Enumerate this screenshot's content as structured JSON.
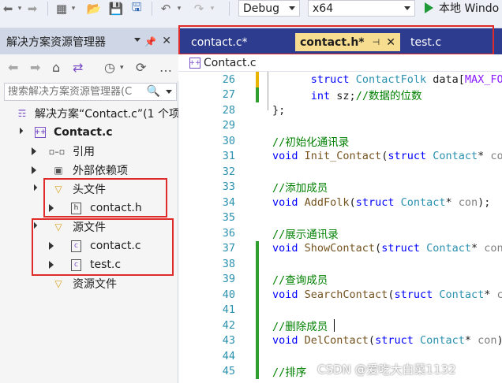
{
  "toolbar": {
    "config": "Debug",
    "platform": "x64",
    "run_label": "本地 Windo"
  },
  "solution_explorer": {
    "title": "解决方案资源管理器",
    "search_placeholder": "搜索解决方案资源管理器(C",
    "solution_label": "解决方案“Contact.c”(1 个项",
    "project_label": "Contact.c",
    "items": {
      "references": "引用",
      "external_deps": "外部依赖项",
      "header_folder": "头文件",
      "header_file": "contact.h",
      "source_folder": "源文件",
      "source_file_1": "contact.c",
      "source_file_2": "test.c",
      "resource_folder": "资源文件"
    }
  },
  "editor": {
    "tabs": [
      {
        "label": "contact.c*",
        "active": false
      },
      {
        "label": "contact.h*",
        "active": true
      },
      {
        "label": "test.c",
        "active": false
      }
    ],
    "nav_project": "Contact.c",
    "lines": [
      {
        "n": "26",
        "parts": [
          [
            "      ",
            "pl"
          ],
          [
            "struct ",
            "kw"
          ],
          [
            "ContactFolk ",
            "ty"
          ],
          [
            "data[",
            "pl"
          ],
          [
            "MAX_FOKL]",
            "mc"
          ]
        ]
      },
      {
        "n": "27",
        "parts": [
          [
            "      ",
            "pl"
          ],
          [
            "int ",
            "kw"
          ],
          [
            "sz;",
            "pl"
          ],
          [
            "//数据的位数",
            "cm"
          ]
        ]
      },
      {
        "n": "28",
        "parts": [
          [
            "};",
            "pl"
          ]
        ]
      },
      {
        "n": "29",
        "parts": []
      },
      {
        "n": "30",
        "parts": [
          [
            "//初始化通讯录",
            "cm"
          ]
        ]
      },
      {
        "n": "31",
        "parts": [
          [
            "void ",
            "kw"
          ],
          [
            "Init_Contact",
            "fn"
          ],
          [
            "(",
            "pl"
          ],
          [
            "struct ",
            "kw"
          ],
          [
            "Contact",
            "ty"
          ],
          [
            "* ",
            "pl"
          ],
          [
            "con",
            "pm"
          ]
        ]
      },
      {
        "n": "32",
        "parts": []
      },
      {
        "n": "33",
        "parts": [
          [
            "//添加成员",
            "cm"
          ]
        ]
      },
      {
        "n": "34",
        "parts": [
          [
            "void ",
            "kw"
          ],
          [
            "AddFolk",
            "fn"
          ],
          [
            "(",
            "pl"
          ],
          [
            "struct ",
            "kw"
          ],
          [
            "Contact",
            "ty"
          ],
          [
            "* ",
            "pl"
          ],
          [
            "con",
            "pm"
          ],
          [
            ");",
            "pl"
          ]
        ]
      },
      {
        "n": "35",
        "parts": []
      },
      {
        "n": "36",
        "parts": [
          [
            "//展示通讯录",
            "cm"
          ]
        ]
      },
      {
        "n": "37",
        "parts": [
          [
            "void ",
            "kw"
          ],
          [
            "ShowContact",
            "fn"
          ],
          [
            "(",
            "pl"
          ],
          [
            "struct ",
            "kw"
          ],
          [
            "Contact",
            "ty"
          ],
          [
            "* ",
            "pl"
          ],
          [
            "con",
            "pm"
          ],
          [
            ")",
            "pl"
          ]
        ]
      },
      {
        "n": "38",
        "parts": []
      },
      {
        "n": "39",
        "parts": [
          [
            "//查询成员",
            "cm"
          ]
        ]
      },
      {
        "n": "40",
        "parts": [
          [
            "void ",
            "kw"
          ],
          [
            "SearchContact",
            "fn"
          ],
          [
            "(",
            "pl"
          ],
          [
            "struct ",
            "kw"
          ],
          [
            "Contact",
            "ty"
          ],
          [
            "* ",
            "pl"
          ],
          [
            "co",
            "pm"
          ]
        ]
      },
      {
        "n": "41",
        "parts": []
      },
      {
        "n": "42",
        "parts": [
          [
            "//删除成员",
            "cm"
          ]
        ]
      },
      {
        "n": "43",
        "parts": [
          [
            "void ",
            "kw"
          ],
          [
            "DelContact",
            "fn"
          ],
          [
            "(",
            "pl"
          ],
          [
            "struct ",
            "kw"
          ],
          [
            "Contact",
            "ty"
          ],
          [
            "* ",
            "pl"
          ],
          [
            "con",
            "pm"
          ],
          [
            ");",
            "pl"
          ]
        ]
      },
      {
        "n": "44",
        "parts": []
      },
      {
        "n": "45",
        "parts": [
          [
            "//排序",
            "cm"
          ]
        ]
      }
    ]
  },
  "watermark": "CSDN @爱吃大白菜1132",
  "colors": {
    "tab_bar": "#2d3c8f",
    "active_tab": "#f7dd8f",
    "highlight_box": "#e02b2b",
    "change_yellow": "#e8b400",
    "change_green": "#2fa02f"
  }
}
